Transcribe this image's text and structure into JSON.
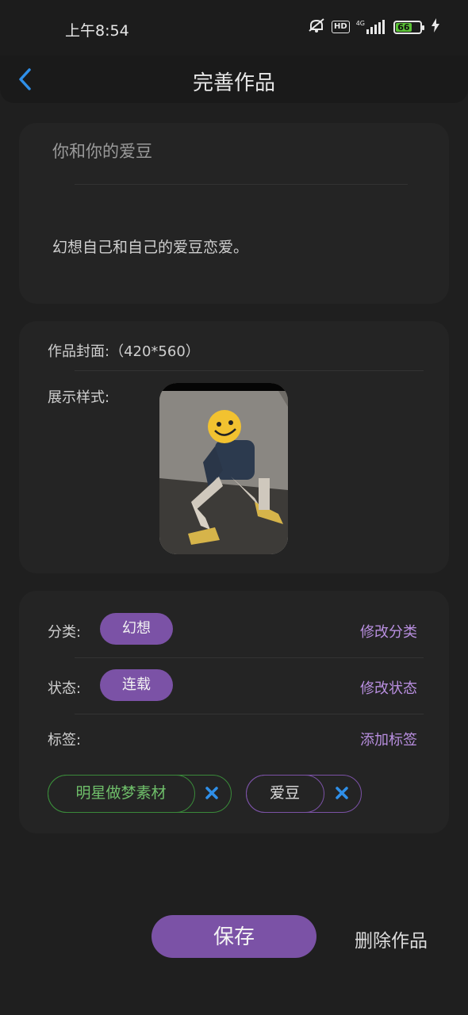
{
  "status_bar": {
    "time": "上午8:54",
    "hd_label": "HD",
    "network_label": "4G",
    "battery_level": "66",
    "battery_color": "#5bc236",
    "icons": [
      "mute-icon",
      "signal-icon",
      "battery-icon",
      "charging-icon"
    ]
  },
  "nav": {
    "title": "完善作品",
    "back_icon": "chevron-left-icon",
    "accent": "#2f8fe8"
  },
  "work": {
    "title": "你和你的爱豆",
    "description": "幻想自己和自己的爱豆恋爱。"
  },
  "cover": {
    "label": "作品封面:（420*560）",
    "style_label": "展示样式:"
  },
  "meta": {
    "category_label": "分类:",
    "category_value": "幻想",
    "category_action": "修改分类",
    "status_label": "状态:",
    "status_value": "连载",
    "status_action": "修改状态",
    "tags_label": "标签:",
    "tags_action": "添加标签",
    "tags": [
      {
        "text": "明星做梦素材",
        "color": "#3a8a3a",
        "text_color": "#6fbf6a"
      },
      {
        "text": "爱豆",
        "color": "#7b52a6",
        "text_color": "#dcdcdc"
      }
    ],
    "pill_color": "#7b52a6",
    "link_color": "#b98fe0",
    "remove_icon_color": "#2f8fe8"
  },
  "actions": {
    "save": "保存",
    "delete": "删除作品"
  }
}
